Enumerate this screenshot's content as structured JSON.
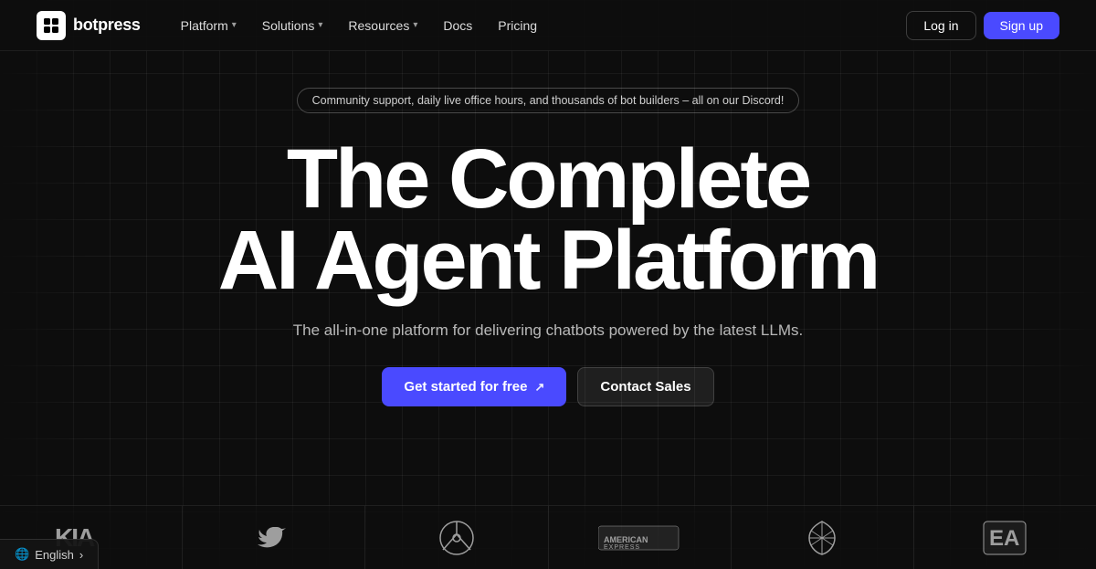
{
  "brand": {
    "logo_text": "botpress",
    "logo_icon": "bp"
  },
  "nav": {
    "links": [
      {
        "label": "Platform",
        "has_dropdown": true
      },
      {
        "label": "Solutions",
        "has_dropdown": true
      },
      {
        "label": "Resources",
        "has_dropdown": true
      },
      {
        "label": "Docs",
        "has_dropdown": false
      },
      {
        "label": "Pricing",
        "has_dropdown": false
      }
    ],
    "login_label": "Log in",
    "signup_label": "Sign up"
  },
  "hero": {
    "banner_text": "Community support, daily live office hours, and thousands of bot builders – all on our Discord!",
    "title_line1": "The Complete",
    "title_line2": "AI Agent Platform",
    "subtitle": "The all-in-one platform for delivering chatbots powered by the latest LLMs.",
    "cta_primary": "Get started for free",
    "cta_secondary": "Contact Sales"
  },
  "logos": [
    {
      "name": "kia",
      "label": "Kia"
    },
    {
      "name": "twitter-bird",
      "label": "Twitter"
    },
    {
      "name": "mercedes",
      "label": "Mercedes"
    },
    {
      "name": "american-express",
      "label": "American Express"
    },
    {
      "name": "shell",
      "label": "Shell"
    },
    {
      "name": "ea",
      "label": "EA"
    }
  ],
  "language_selector": {
    "label": "English",
    "chevron": "›"
  }
}
